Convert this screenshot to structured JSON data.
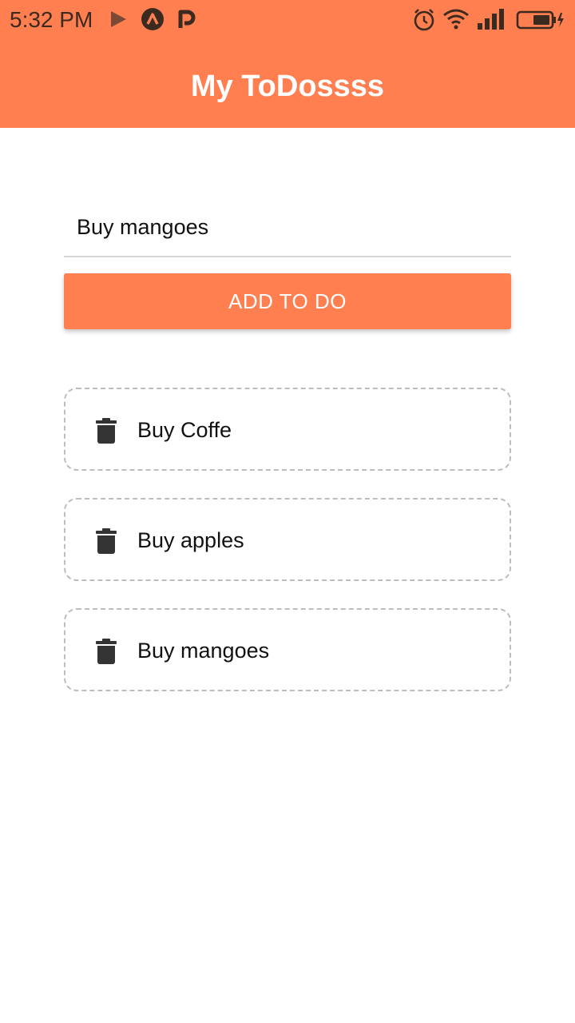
{
  "status_bar": {
    "time": "5:32 PM",
    "left_icons": [
      "play-icon",
      "app-a-icon",
      "app-p-icon"
    ],
    "right_icons": [
      "alarm-icon",
      "wifi-icon",
      "signal-icon",
      "battery-icon"
    ]
  },
  "header": {
    "title": "My ToDossss"
  },
  "form": {
    "input_value": "Buy mangoes",
    "add_button_label": "ADD TO DO"
  },
  "todos": [
    {
      "text": "Buy Coffe",
      "icon": "trash-icon"
    },
    {
      "text": "Buy apples",
      "icon": "trash-icon"
    },
    {
      "text": "Buy mangoes",
      "icon": "trash-icon"
    }
  ],
  "colors": {
    "accent": "#ff7f50",
    "status_icon": "#3b2a20",
    "card_border": "#bdbdbd",
    "icon_dark": "#333333"
  }
}
